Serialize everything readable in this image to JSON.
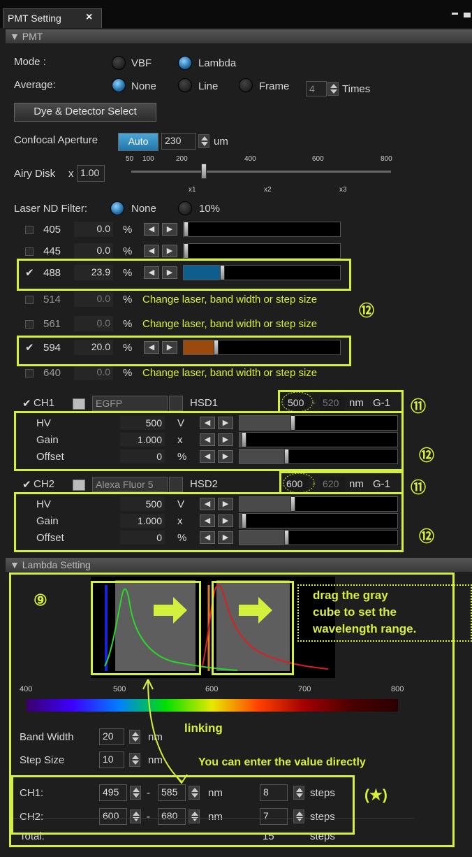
{
  "window": {
    "tab_title": "PMT Setting",
    "close": "×"
  },
  "pmt": {
    "header": "▼ PMT",
    "mode_label": "Mode :",
    "mode_vbf": "VBF",
    "mode_lambda": "Lambda",
    "avg_label": "Average:",
    "avg_none": "None",
    "avg_line": "Line",
    "avg_frame": "Frame",
    "avg_count": "4",
    "avg_times": "Times",
    "dye_button": "Dye & Detector Select",
    "aperture_label": "Confocal Aperture",
    "aperture_auto": "Auto",
    "aperture_value": "230",
    "aperture_unit": "um",
    "airy_label": "Airy Disk",
    "airy_x": "x",
    "airy_value": "1.00",
    "airy_top_ticks": [
      "50",
      "100",
      "200",
      "400",
      "600",
      "800"
    ],
    "airy_bottom_ticks": [
      "x1",
      "x2",
      "x3"
    ],
    "airy_level": 0.28,
    "nd_label": "Laser ND Filter:",
    "nd_none": "None",
    "nd_10": "10%",
    "lasers": [
      {
        "wl": "405",
        "value": "0.0",
        "unit": "%",
        "checked": false,
        "mode": "slider",
        "fill": 0,
        "color": "#000"
      },
      {
        "wl": "445",
        "value": "0.0",
        "unit": "%",
        "checked": false,
        "mode": "slider",
        "fill": 0,
        "color": "#000"
      },
      {
        "wl": "488",
        "value": "23.9",
        "unit": "%",
        "checked": true,
        "mode": "slider",
        "fill": 0.239,
        "color": "#0f5d8c"
      },
      {
        "wl": "514",
        "value": "0.0",
        "unit": "%",
        "checked": false,
        "mode": "note"
      },
      {
        "wl": "561",
        "value": "0.0",
        "unit": "%",
        "checked": false,
        "mode": "note"
      },
      {
        "wl": "594",
        "value": "20.0",
        "unit": "%",
        "checked": true,
        "mode": "slider",
        "fill": 0.2,
        "color": "#9a4a0c"
      },
      {
        "wl": "640",
        "value": "0.0",
        "unit": "%",
        "checked": false,
        "mode": "note"
      }
    ],
    "laser_note": "Change laser, band width or step size",
    "channels": [
      {
        "name": "CH1",
        "dye": "EGFP",
        "detector": "HSD1",
        "from": "500",
        "to": "520",
        "unit": "nm",
        "gain_group": "G-1",
        "rows": [
          {
            "label": "HV",
            "value": "500",
            "unit": "V",
            "fill": 0.33
          },
          {
            "label": "Gain",
            "value": "1.000",
            "unit": "x",
            "fill": 0.02
          },
          {
            "label": "Offset",
            "value": "0",
            "unit": "%",
            "fill": 0.29
          }
        ]
      },
      {
        "name": "CH2",
        "dye": "Alexa Fluor 5",
        "detector": "HSD2",
        "from": "600",
        "to": "620",
        "unit": "nm",
        "gain_group": "G-1",
        "rows": [
          {
            "label": "HV",
            "value": "500",
            "unit": "V",
            "fill": 0.33
          },
          {
            "label": "Gain",
            "value": "1.000",
            "unit": "x",
            "fill": 0.02
          },
          {
            "label": "Offset",
            "value": "0",
            "unit": "%",
            "fill": 0.29
          }
        ]
      }
    ]
  },
  "lambda": {
    "header": "▼ Lambda Setting",
    "axis_ticks": [
      "400",
      "500",
      "600",
      "700",
      "800"
    ],
    "band_width_label": "Band Width",
    "band_width": "20",
    "band_unit": "nm",
    "step_size_label": "Step Size",
    "step_size": "10",
    "step_unit": "nm",
    "ranges": [
      {
        "name": "CH1:",
        "from": "495",
        "to": "585",
        "unit": "nm",
        "steps": "8",
        "steps_label": "steps"
      },
      {
        "name": "CH2:",
        "from": "600",
        "to": "680",
        "unit": "nm",
        "steps": "7",
        "steps_label": "steps"
      }
    ],
    "total_label": "Total:",
    "total_steps": "15",
    "total_unit": "steps"
  },
  "annotations": {
    "n9": "⑨",
    "n11a": "⑪",
    "n11b": "⑪",
    "n12a": "⑫",
    "n12b": "⑫",
    "n12c": "⑫",
    "drag_note": [
      "drag the gray",
      "cube to set the",
      "wavelength range."
    ],
    "linking": "linking",
    "direct": "You can enter the value directly",
    "star": "(★)"
  },
  "colors": {
    "accent_yellow": "#d2f03c",
    "radio_on": "#1f6fa8",
    "laser488": "#0f5d8c",
    "laser594": "#9a4a0c"
  }
}
